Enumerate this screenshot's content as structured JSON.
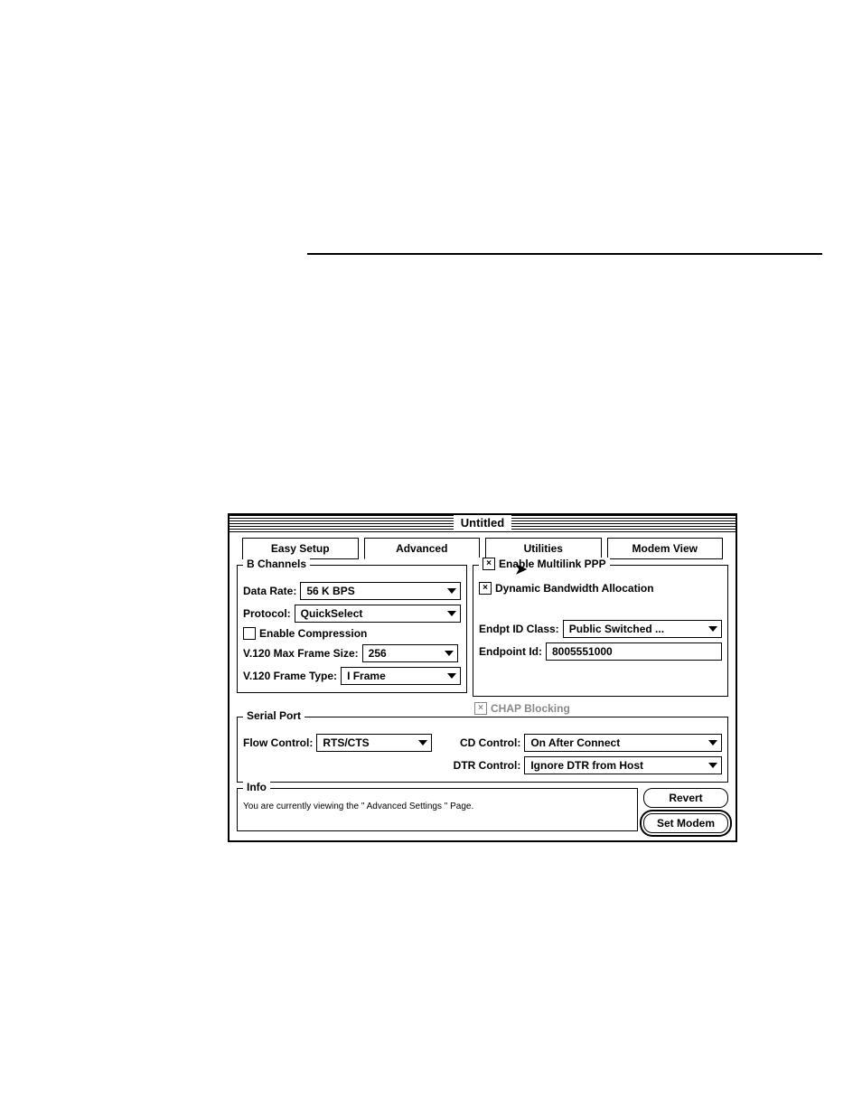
{
  "window_title": "Untitled",
  "tabs": {
    "easy_setup": "Easy Setup",
    "advanced": "Advanced",
    "utilities": "Utilities",
    "modem_view": "Modem View"
  },
  "b_channels": {
    "legend": "B Channels",
    "data_rate_label": "Data Rate:",
    "data_rate_value": "56 K BPS",
    "protocol_label": "Protocol:",
    "protocol_value": "QuickSelect",
    "enable_compression_label": "Enable Compression",
    "enable_compression_checked": false,
    "v120_max_label": "V.120 Max Frame Size:",
    "v120_max_value": "256",
    "v120_frame_type_label": "V.120 Frame Type:",
    "v120_frame_type_value": "I Frame"
  },
  "multilink": {
    "legend": "Enable Multilink PPP",
    "legend_checked": true,
    "dyn_bw_label": "Dynamic Bandwidth Allocation",
    "dyn_bw_checked": true,
    "endpt_class_label": "Endpt ID Class:",
    "endpt_class_value": "Public Switched ...",
    "endpoint_id_label": "Endpoint Id:",
    "endpoint_id_value": "8005551000",
    "chap_blocking_label": "CHAP Blocking",
    "chap_blocking_checked": true
  },
  "serial": {
    "legend": "Serial Port",
    "flow_label": "Flow Control:",
    "flow_value": "RTS/CTS",
    "cd_label": "CD Control:",
    "cd_value": "On After Connect",
    "dtr_label": "DTR Control:",
    "dtr_value": "Ignore DTR from Host"
  },
  "info": {
    "legend": "Info",
    "text": "You are currently viewing the \" Advanced Settings \" Page."
  },
  "buttons": {
    "revert": "Revert",
    "set_modem": "Set Modem"
  }
}
